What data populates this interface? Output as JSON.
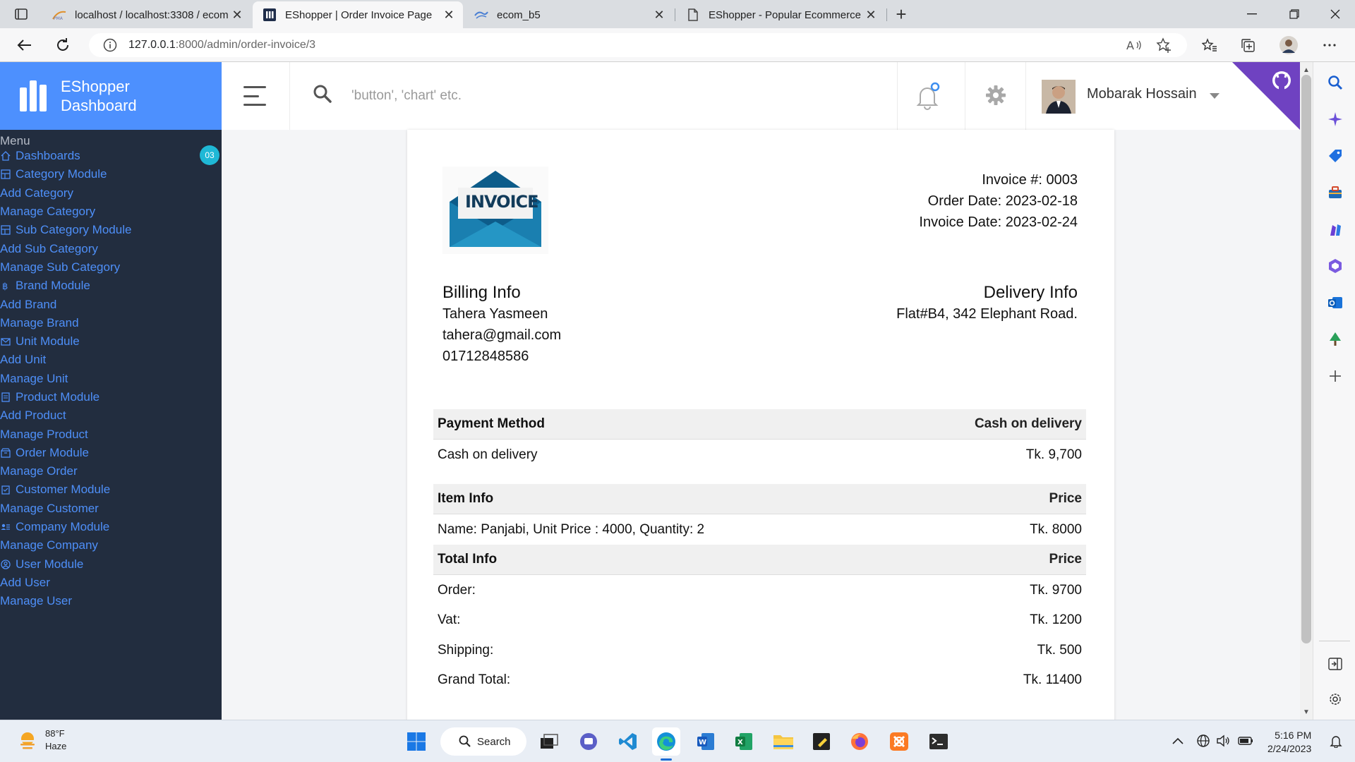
{
  "browser": {
    "tabs": [
      {
        "title": "localhost / localhost:3308 / ecom",
        "favicon": "phpmyadmin-icon"
      },
      {
        "title": "EShopper | Order Invoice Page",
        "favicon": "eshopper-icon"
      },
      {
        "title": "ecom_b5",
        "favicon": "db-icon"
      },
      {
        "title": "EShopper - Popular Ecommerce",
        "favicon": "page-icon"
      }
    ],
    "url_host": "127.0.0.1",
    "url_path": ":8000/admin/order-invoice/3"
  },
  "app": {
    "brand_line1": "EShopper",
    "brand_line2": "Dashboard",
    "search_placeholder": "'button', 'chart' etc.",
    "username": "Mobarak Hossain"
  },
  "sidebar": {
    "heading": "Menu",
    "badge": "03",
    "items": [
      {
        "label": "Dashboards",
        "icon": "home-icon"
      },
      {
        "label": "Category Module",
        "icon": "grid-icon"
      },
      {
        "label": "Add Category",
        "icon": ""
      },
      {
        "label": "Manage Category",
        "icon": ""
      },
      {
        "label": "Sub Category Module",
        "icon": "grid-icon"
      },
      {
        "label": "Add Sub Category",
        "icon": ""
      },
      {
        "label": "Manage Sub Category",
        "icon": ""
      },
      {
        "label": "Brand Module",
        "icon": "bitcoin-icon"
      },
      {
        "label": "Add Brand",
        "icon": ""
      },
      {
        "label": "Manage Brand",
        "icon": ""
      },
      {
        "label": "Unit Module",
        "icon": "mail-icon"
      },
      {
        "label": "Add Unit",
        "icon": ""
      },
      {
        "label": "Manage Unit",
        "icon": ""
      },
      {
        "label": "Product Module",
        "icon": "doc-icon"
      },
      {
        "label": "Add Product",
        "icon": ""
      },
      {
        "label": "Manage Product",
        "icon": ""
      },
      {
        "label": "Order Module",
        "icon": "box-icon"
      },
      {
        "label": "Manage Order",
        "icon": ""
      },
      {
        "label": "Customer Module",
        "icon": "clipboard-icon"
      },
      {
        "label": "Manage Customer",
        "icon": ""
      },
      {
        "label": "Company Module",
        "icon": "users-icon"
      },
      {
        "label": "Manage Company",
        "icon": ""
      },
      {
        "label": "User Module",
        "icon": "user-circle-icon"
      },
      {
        "label": "Add User",
        "icon": ""
      },
      {
        "label": "Manage User",
        "icon": ""
      }
    ]
  },
  "invoice": {
    "logo_text": "INVOICE",
    "invoice_no": "Invoice #: 0003",
    "order_date": "Order Date: 2023-02-18",
    "invoice_date": "Invoice Date: 2023-02-24",
    "billing": {
      "title": "Billing Info",
      "name": "Tahera Yasmeen",
      "email": "tahera@gmail.com",
      "phone": "01712848586"
    },
    "delivery": {
      "title": "Delivery Info",
      "address": "Flat#B4, 342 Elephant Road."
    },
    "payment": {
      "head_left": "Payment Method",
      "head_right": "Cash on delivery",
      "row_left": "Cash on delivery",
      "row_right": "Tk. 9,700"
    },
    "items": {
      "head_left": "Item Info",
      "head_right": "Price",
      "rows": [
        {
          "left": "Name: Panjabi, Unit Price : 4000, Quantity: 2",
          "right": "Tk. 8000"
        }
      ]
    },
    "totals": {
      "head_left": "Total Info",
      "head_right": "Price",
      "rows": [
        {
          "left": "Order:",
          "right": "Tk. 9700"
        },
        {
          "left": "Vat:",
          "right": "Tk. 1200"
        },
        {
          "left": "Shipping:",
          "right": "Tk. 500"
        },
        {
          "left": "Grand Total:",
          "right": "Tk. 11400"
        }
      ]
    }
  },
  "taskbar": {
    "weather_temp": "88°F",
    "weather_desc": "Haze",
    "search_label": "Search",
    "time": "5:16 PM",
    "date": "2/24/2023"
  },
  "colors": {
    "brand_blue": "#4d90fe",
    "sidebar_bg": "#222d3f",
    "sidebar_link": "#4e8ff8",
    "badge": "#1fb8d6",
    "ribbon": "#6f42c1"
  }
}
